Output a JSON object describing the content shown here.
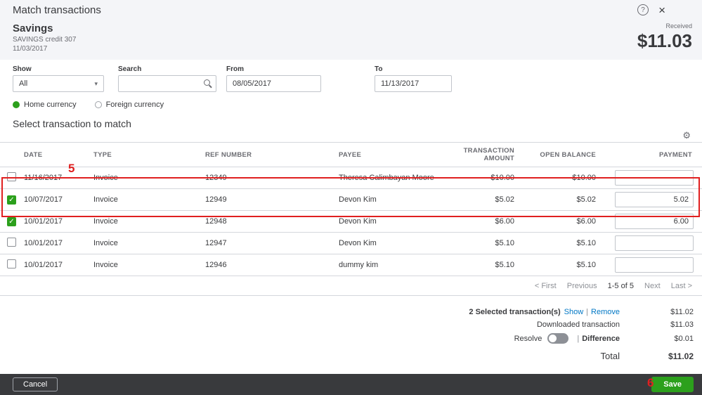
{
  "header": {
    "title": "Match transactions"
  },
  "icons": {
    "help": "?",
    "close": "×",
    "gear": "⚙",
    "dropdown_caret": "▾",
    "checkbox_tick": "✓"
  },
  "colors": {
    "accent_green": "#2ca01c",
    "link_blue": "#0077c5",
    "footer_dark": "#393a3d",
    "annotation_red": "#e02020"
  },
  "account": {
    "name": "Savings",
    "subtitle": "SAVINGS credit 307",
    "date": "11/03/2017",
    "received_label": "Received",
    "received_amount": "$11.03"
  },
  "filters": {
    "show_label": "Show",
    "show_value": "All",
    "search_label": "Search",
    "search_value": "",
    "from_label": "From",
    "from_value": "08/05/2017",
    "to_label": "To",
    "to_value": "11/13/2017"
  },
  "currency": {
    "home_label": "Home currency",
    "foreign_label": "Foreign currency",
    "selected": "Home currency"
  },
  "section_title": "Select transaction to match",
  "table": {
    "headers": [
      "DATE",
      "TYPE",
      "REF NUMBER",
      "PAYEE",
      "TRANSACTION AMOUNT",
      "OPEN BALANCE",
      "PAYMENT"
    ],
    "rows": [
      {
        "checked": false,
        "date": "11/16/2017",
        "type": "Invoice",
        "ref": "12349",
        "payee": "Theresa Calimbayan Moore",
        "amount": "$10.00",
        "balance": "$10.00",
        "payment": ""
      },
      {
        "checked": true,
        "date": "10/07/2017",
        "type": "Invoice",
        "ref": "12949",
        "payee": "Devon Kim",
        "amount": "$5.02",
        "balance": "$5.02",
        "payment": "5.02"
      },
      {
        "checked": true,
        "date": "10/01/2017",
        "type": "Invoice",
        "ref": "12948",
        "payee": "Devon Kim",
        "amount": "$6.00",
        "balance": "$6.00",
        "payment": "6.00"
      },
      {
        "checked": false,
        "date": "10/01/2017",
        "type": "Invoice",
        "ref": "12947",
        "payee": "Devon Kim",
        "amount": "$5.10",
        "balance": "$5.10",
        "payment": ""
      },
      {
        "checked": false,
        "date": "10/01/2017",
        "type": "Invoice",
        "ref": "12946",
        "payee": "dummy kim",
        "amount": "$5.10",
        "balance": "$5.10",
        "payment": ""
      }
    ]
  },
  "pagination": {
    "first": "< First",
    "previous": "Previous",
    "range": "1-5 of 5",
    "next": "Next",
    "last": "Last >"
  },
  "summary": {
    "selected_label": "2 Selected transaction(s)",
    "show_link": "Show",
    "remove_link": "Remove",
    "selected_amount": "$11.02",
    "downloaded_label": "Downloaded transaction",
    "downloaded_amount": "$11.03",
    "resolve_label": "Resolve",
    "difference_label": "Difference",
    "difference_amount": "$0.01",
    "total_label": "Total",
    "total_amount": "$11.02"
  },
  "footer": {
    "cancel_label": "Cancel",
    "save_label": "Save"
  },
  "annotations": {
    "step_5": "5",
    "step_6": "6"
  }
}
